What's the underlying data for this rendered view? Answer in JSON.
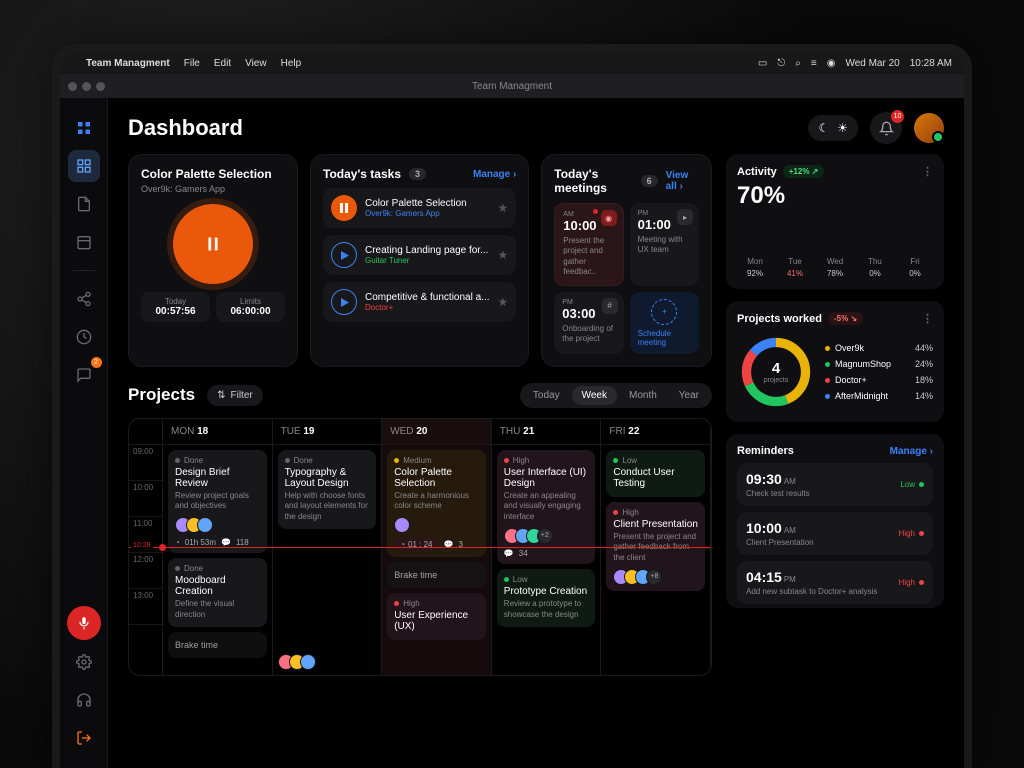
{
  "menubar": {
    "app": "Team Managment",
    "items": [
      "File",
      "Edit",
      "View",
      "Help"
    ],
    "date": "Wed Mar 20",
    "time": "10:28 AM"
  },
  "window_title": "Team Managment",
  "page_title": "Dashboard",
  "notif_count": "10",
  "sidebar_badge": "2",
  "timer_card": {
    "title": "Color Palette Selection",
    "project": "Over9k: Gamers App",
    "today_label": "Today",
    "today_value": "00:57:56",
    "limits_label": "Limits",
    "limits_value": "06:00:00"
  },
  "tasks": {
    "title": "Today's tasks",
    "count": "3",
    "manage": "Manage",
    "items": [
      {
        "name": "Color Palette Selection",
        "project": "Over9k: Gamers App",
        "project_color": "#3b82f6",
        "playing": true
      },
      {
        "name": "Creating Landing page for...",
        "project": "Guitar Tuner",
        "project_color": "#22c55e",
        "playing": false
      },
      {
        "name": "Competitive & functional a...",
        "project": "Doctor+",
        "project_color": "#ef4444",
        "playing": false
      }
    ]
  },
  "meetings": {
    "title": "Today's meetings",
    "count": "6",
    "viewall": "View all",
    "schedule": "Schedule meeting",
    "items": [
      {
        "ampm": "AM",
        "time": "10:00",
        "desc": "Present the project and gather feedbac..",
        "hi": true
      },
      {
        "ampm": "PM",
        "time": "01:00",
        "desc": "Meeting with UX team"
      },
      {
        "ampm": "PM",
        "time": "03:00",
        "desc": "Onboarding of the project"
      }
    ]
  },
  "projects": {
    "title": "Projects",
    "filter": "Filter",
    "tabs": [
      "Today",
      "Week",
      "Month",
      "Year"
    ],
    "active_tab": "Week",
    "now_label": "10:28",
    "time_slots": [
      "09:00",
      "10:00",
      "11:00",
      "12:00",
      "13:00"
    ],
    "days": [
      {
        "label": "MON",
        "num": "18"
      },
      {
        "label": "TUE",
        "num": "19"
      },
      {
        "label": "WED",
        "num": "20"
      },
      {
        "label": "THU",
        "num": "21"
      },
      {
        "label": "FRI",
        "num": "22"
      }
    ],
    "events": {
      "mon": [
        {
          "pri": "Done",
          "title": "Design Brief Review",
          "desc": "Review project goals and objectives",
          "footer_time": "01h 53m",
          "footer_count": "118"
        },
        {
          "pri": "Done",
          "title": "Moodboard Creation",
          "desc": "Define the visual direction"
        },
        {
          "pri": "",
          "title": "Brake time"
        }
      ],
      "tue": [
        {
          "pri": "Done",
          "title": "Typography & Layout Design",
          "desc": "Help with choose fonts and layout elements for the design"
        }
      ],
      "wed": [
        {
          "pri": "Medium",
          "title": "Color Palette Selection",
          "desc": "Create a harmonious color scheme",
          "footer_timer": "01 : 24",
          "footer_count": "3"
        },
        {
          "pri": "",
          "title": "Brake time"
        },
        {
          "pri": "High",
          "title": "User Experience (UX)"
        }
      ],
      "thu": [
        {
          "pri": "High",
          "title": "User Interface (UI) Design",
          "desc": "Create an appealing and visually engaging interface",
          "footer_count": "34"
        },
        {
          "pri": "Low",
          "title": "Prototype Creation",
          "desc": "Review a prototype to showcase the design"
        }
      ],
      "fri": [
        {
          "pri": "Low",
          "title": "Conduct User Testing"
        },
        {
          "pri": "High",
          "title": "Client Presentation",
          "desc": "Present the project and gather feedback from the client",
          "footer_more": "+8"
        }
      ]
    }
  },
  "activity": {
    "title": "Activity",
    "delta": "+12%",
    "value": "70%",
    "days": [
      {
        "d": "Mon",
        "p": "92%"
      },
      {
        "d": "Tue",
        "p": "41%",
        "red": true
      },
      {
        "d": "Wed",
        "p": "78%"
      },
      {
        "d": "Thu",
        "p": "0%"
      },
      {
        "d": "Fri",
        "p": "0%"
      }
    ]
  },
  "projects_worked": {
    "title": "Projects worked",
    "delta": "-5%",
    "center_num": "4",
    "center_label": "projects",
    "legend": [
      {
        "name": "Over9k",
        "pct": "44%",
        "color": "#eab308"
      },
      {
        "name": "MagnumShop",
        "pct": "24%",
        "color": "#22c55e"
      },
      {
        "name": "Doctor+",
        "pct": "18%",
        "color": "#ef4444"
      },
      {
        "name": "AfterMidnight",
        "pct": "14%",
        "color": "#3b82f6"
      }
    ]
  },
  "reminders": {
    "title": "Reminders",
    "manage": "Manage",
    "items": [
      {
        "time": "09:30",
        "ampm": "AM",
        "desc": "Check test results",
        "pri": "Low",
        "pri_color": "#22c55e"
      },
      {
        "time": "10:00",
        "ampm": "AM",
        "desc": "Client Presentation",
        "pri": "High",
        "pri_color": "#ef4444"
      },
      {
        "time": "04:15",
        "ampm": "PM",
        "desc": "Add new subtask to Doctor+ analysis",
        "pri": "High",
        "pri_color": "#ef4444"
      }
    ]
  },
  "chart_data": [
    {
      "type": "bar",
      "title": "Activity",
      "categories": [
        "Mon",
        "Tue",
        "Wed",
        "Thu",
        "Fri"
      ],
      "values": [
        92,
        41,
        78,
        0,
        0
      ],
      "ylabel": "%",
      "ylim": [
        0,
        100
      ]
    },
    {
      "type": "pie",
      "title": "Projects worked",
      "series": [
        {
          "name": "Over9k",
          "value": 44
        },
        {
          "name": "MagnumShop",
          "value": 24
        },
        {
          "name": "Doctor+",
          "value": 18
        },
        {
          "name": "AfterMidnight",
          "value": 14
        }
      ]
    }
  ]
}
